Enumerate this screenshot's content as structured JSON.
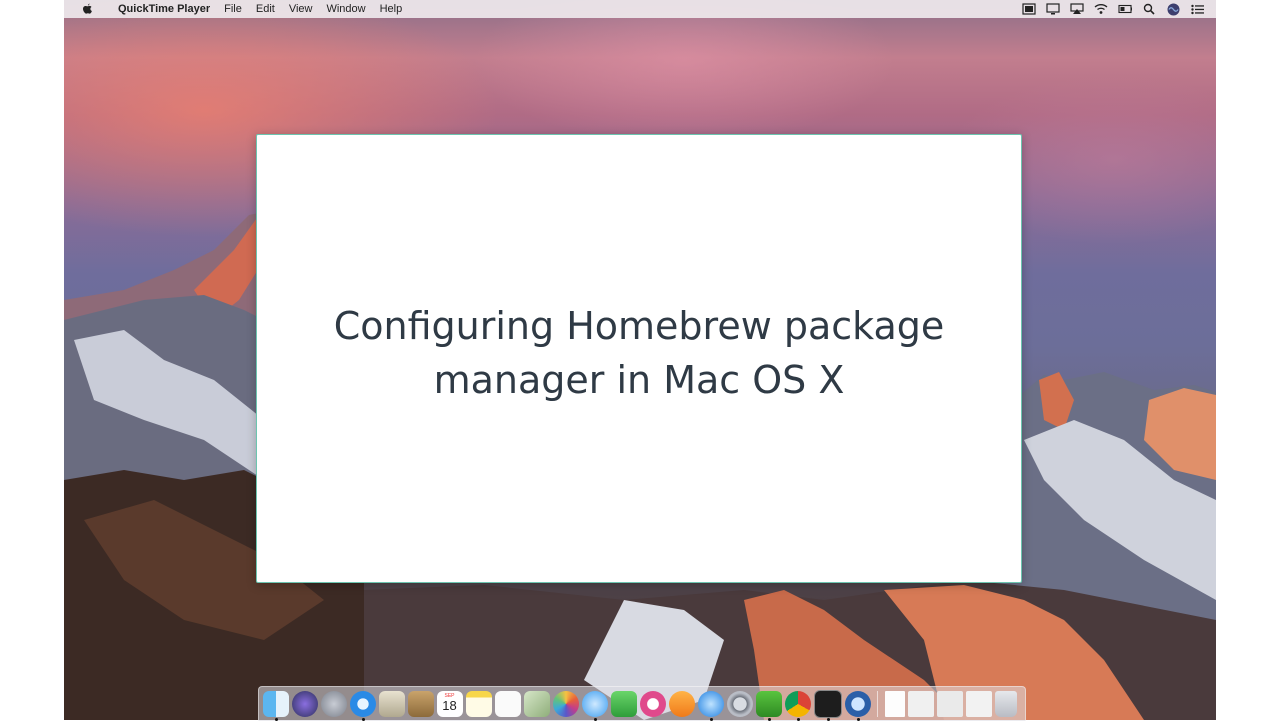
{
  "menubar": {
    "apple_icon": "apple-logo-icon",
    "app_name": "QuickTime Player",
    "menus": [
      "File",
      "Edit",
      "View",
      "Window",
      "Help"
    ],
    "status_icons": [
      "screen-recording-icon",
      "display-mirroring-icon",
      "airplay-icon",
      "wifi-icon",
      "battery-icon",
      "spotlight-search-icon",
      "siri-icon",
      "notification-center-icon"
    ]
  },
  "slide": {
    "title": "Configuring Homebrew package\nmanager in Mac OS X",
    "border_color": "#6cc5b0",
    "text_color": "#2f3a45"
  },
  "dock": {
    "calendar_day": "18",
    "calendar_month": "SEP",
    "apps": [
      "finder-icon",
      "siri-icon",
      "launchpad-icon",
      "safari-icon",
      "mail-icon",
      "contacts-icon",
      "calendar-icon",
      "notes-icon",
      "reminders-icon",
      "preview-icon",
      "photos-icon",
      "messages-icon",
      "facetime-icon",
      "itunes-icon",
      "ibooks-icon",
      "app-store-icon",
      "system-preferences-icon",
      "camtasia-icon",
      "chrome-icon",
      "terminal-icon",
      "quicktime-icon"
    ],
    "documents": [
      "document-icon",
      "screenshot-stack-icon",
      "screenshot-stack-icon",
      "screenshot-stack-icon",
      "trash-icon"
    ]
  }
}
